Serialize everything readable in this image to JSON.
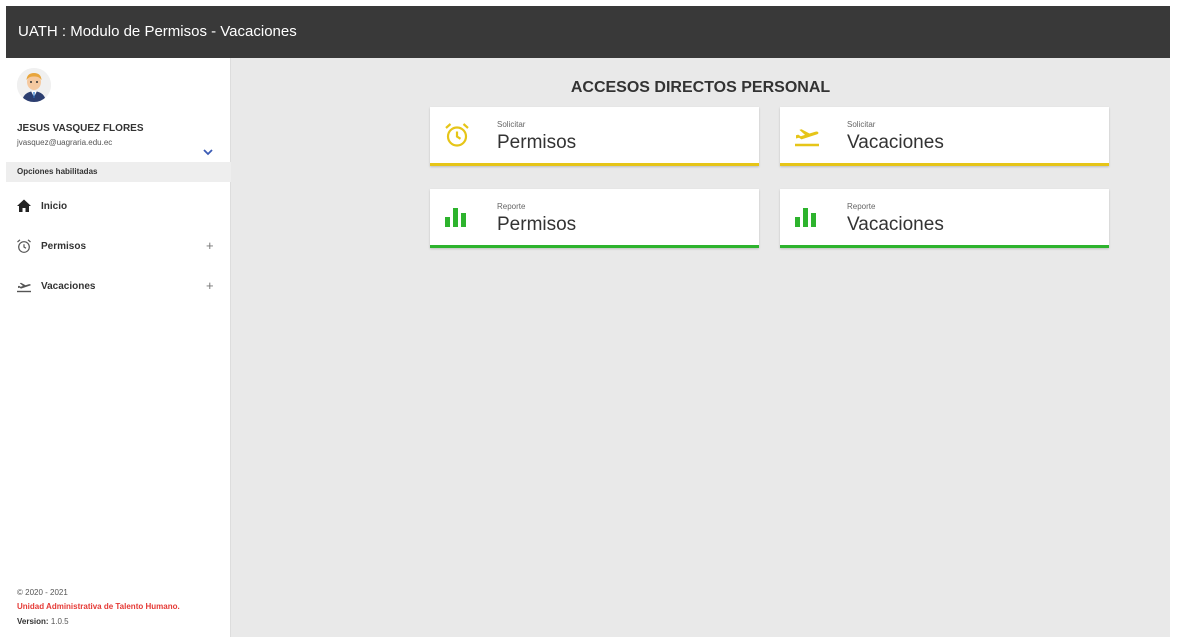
{
  "app": {
    "title": "UATH : Modulo de Permisos - Vacaciones"
  },
  "user": {
    "name": "JESUS VASQUEZ FLORES",
    "email": "jvasquez@uagraria.edu.ec"
  },
  "sidebar": {
    "section_label": "Opciones habilitadas",
    "items": [
      {
        "label": "Inicio",
        "icon": "home-icon"
      },
      {
        "label": "Permisos",
        "icon": "alarm-clock-icon",
        "expand": "+"
      },
      {
        "label": "Vacaciones",
        "icon": "flight-takeoff-icon",
        "expand": "+"
      }
    ],
    "footer": {
      "copyright": "© 2020 - 2021",
      "unit": "Unidad Administrativa de Talento Humano.",
      "version_label": "Version:",
      "version": "1.0.5"
    }
  },
  "main": {
    "heading": "ACCESOS DIRECTOS PERSONAL",
    "cards": [
      {
        "small": "Solicitar",
        "big": "Permisos",
        "icon": "alarm-clock-icon"
      },
      {
        "small": "Solicitar",
        "big": "Vacaciones",
        "icon": "flight-takeoff-icon"
      },
      {
        "small": "Reporte",
        "big": "Permisos",
        "icon": "bar-chart-icon"
      },
      {
        "small": "Reporte",
        "big": "Vacaciones",
        "icon": "bar-chart-icon"
      }
    ]
  },
  "colors": {
    "topbar": "#393939",
    "accent_yellow": "#e6c518",
    "accent_green": "#2db32d",
    "footer_red": "#e53935",
    "chevron_blue": "#3b5bb5"
  }
}
